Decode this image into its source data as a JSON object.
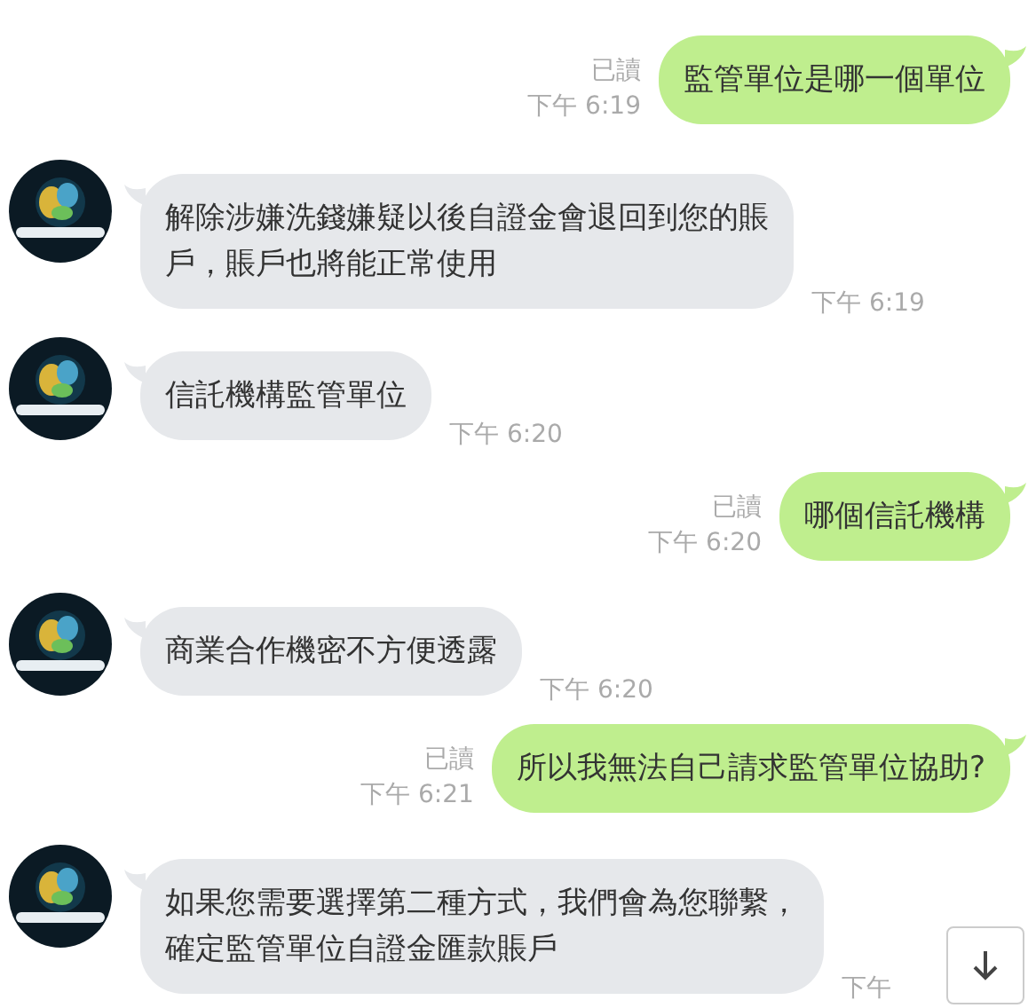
{
  "messages": [
    {
      "kind": "out",
      "lines": [
        "監管單位是哪一個單位"
      ],
      "read": "已讀",
      "time": "下午 6:19"
    },
    {
      "kind": "in",
      "lines": [
        "解除涉嫌洗錢嫌疑以後自證金會退回到您的賬",
        "戶，賬戶也將能正常使用"
      ],
      "time": "下午 6:19"
    },
    {
      "kind": "in",
      "lines": [
        "信託機構監管單位"
      ],
      "time": "下午 6:20"
    },
    {
      "kind": "out",
      "lines": [
        "哪個信託機構"
      ],
      "read": "已讀",
      "time": "下午 6:20"
    },
    {
      "kind": "in",
      "lines": [
        "商業合作機密不方便透露"
      ],
      "time": "下午 6:20"
    },
    {
      "kind": "out",
      "lines": [
        "所以我無法自己請求監管單位協助?"
      ],
      "read": "已讀",
      "time": "下午 6:21"
    },
    {
      "kind": "in",
      "lines": [
        "如果您需要選擇第二種方式，我們會為您聯繫，",
        "確定監管單位自證金匯款賬戶"
      ],
      "time": "下午"
    }
  ]
}
